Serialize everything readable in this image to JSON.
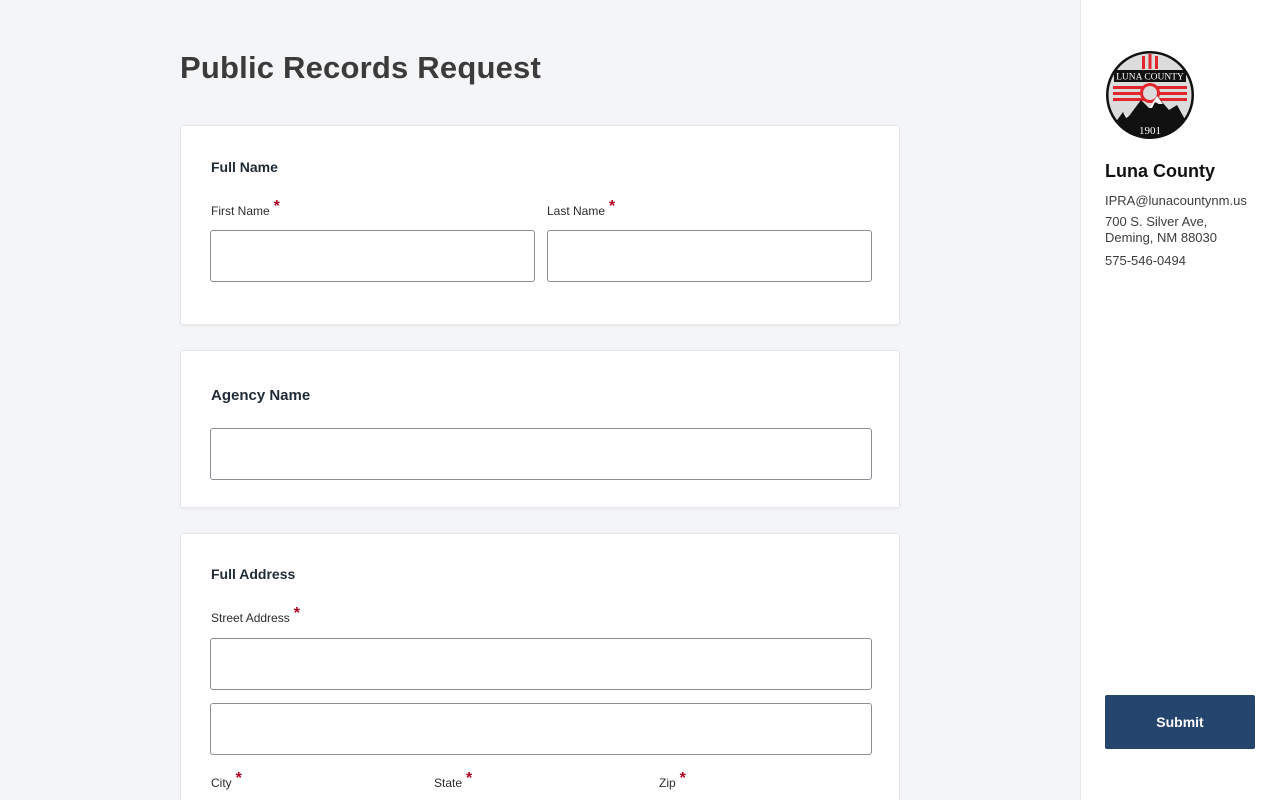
{
  "page": {
    "title": "Public Records Request"
  },
  "full_name": {
    "title": "Full Name",
    "first_name_label": "First Name",
    "last_name_label": "Last Name",
    "required_mark": "*",
    "first_name_value": "",
    "last_name_value": ""
  },
  "agency": {
    "title": "Agency Name",
    "value": ""
  },
  "address": {
    "title": "Full Address",
    "street_label": "Street Address",
    "city_label": "City",
    "state_label": "State",
    "zip_label": "Zip",
    "required_mark": "*",
    "street_line1_value": "",
    "street_line2_value": ""
  },
  "sidebar": {
    "org_name": "Luna County",
    "email": "IPRA@lunacountynm.us",
    "address_line1": "700 S. Silver Ave,",
    "address_line2": "Deming, NM 88030",
    "phone": "575-546-0494",
    "seal_top_text": "LUNA COUNTY",
    "seal_year": "1901",
    "submit_label": "Submit"
  },
  "colors": {
    "background": "#f4f5f7",
    "required": "#b00020",
    "submit": "#26456e",
    "seal_red": "#e3262b"
  }
}
